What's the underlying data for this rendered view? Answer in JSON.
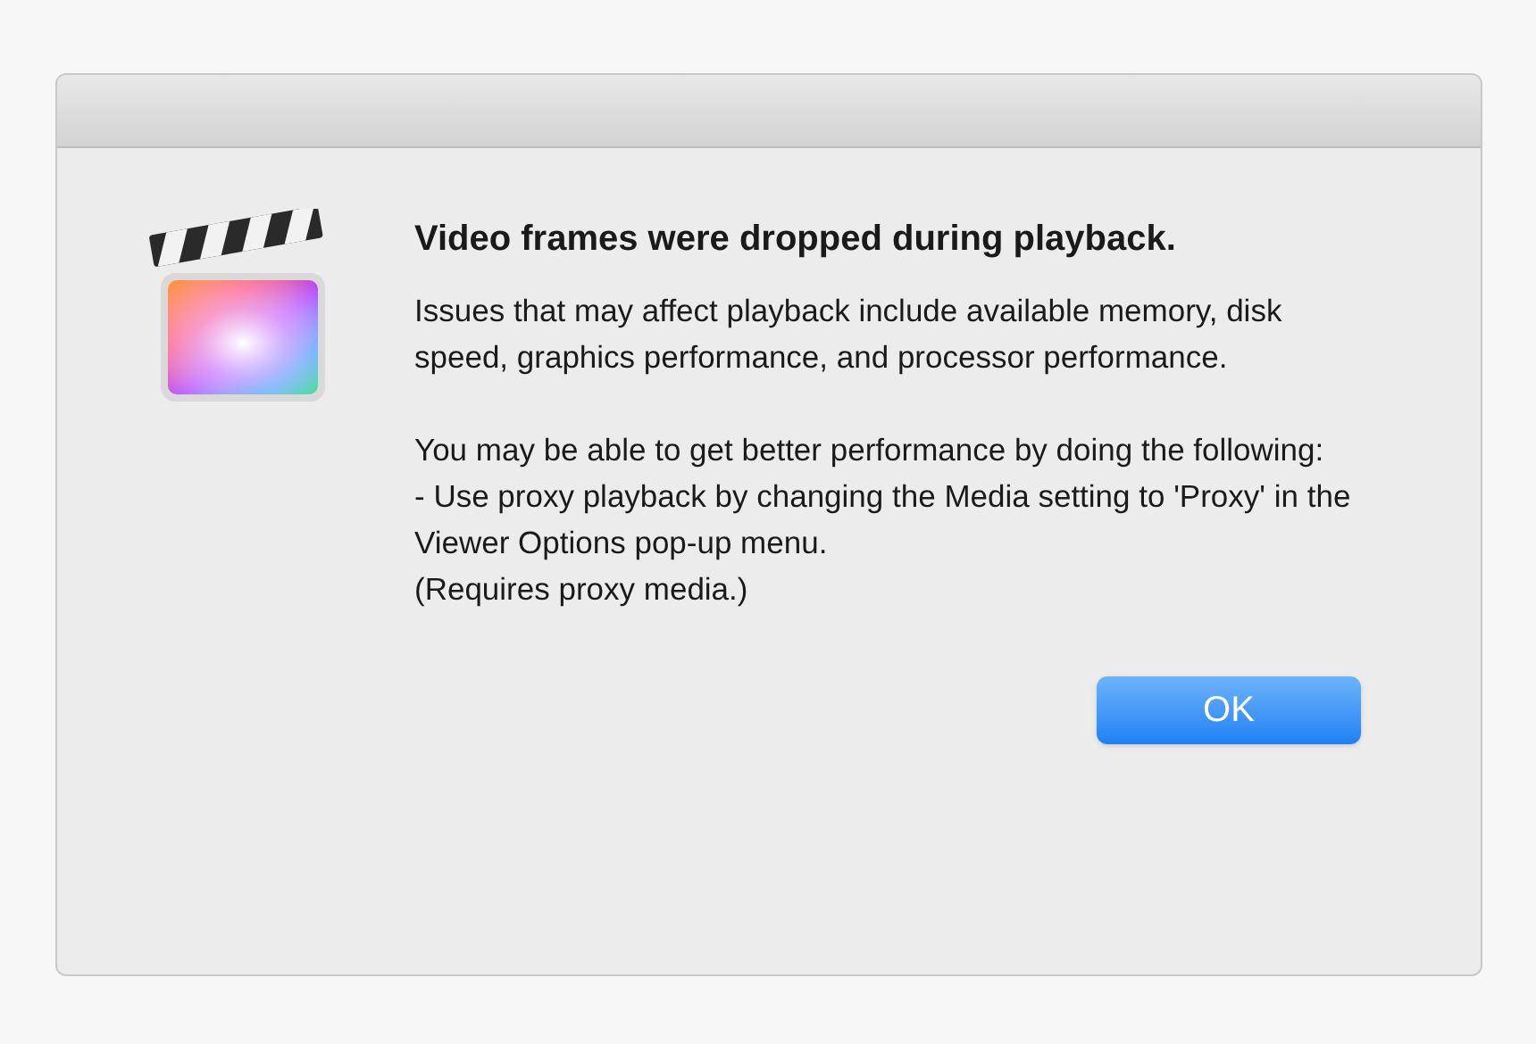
{
  "dialog": {
    "title": "Video frames were dropped during playback.",
    "paragraphs": [
      "Issues that may affect playback include available memory, disk speed, graphics performance, and processor performance.",
      "You may be able to get better performance by doing the following:"
    ],
    "list_lines": [
      "- Use proxy playback by changing the Media setting to 'Proxy' in the Viewer Options pop-up menu.",
      "(Requires proxy media.)"
    ],
    "buttons": [
      "OK"
    ]
  }
}
